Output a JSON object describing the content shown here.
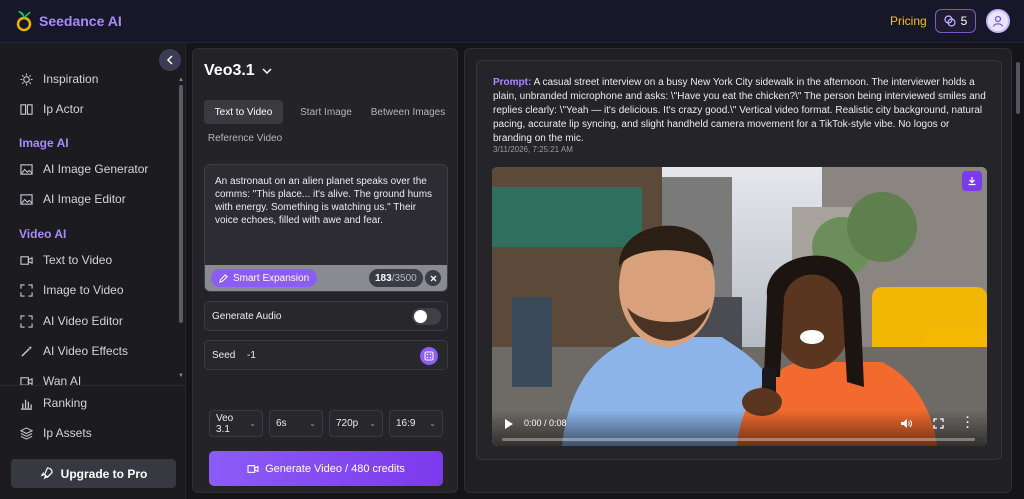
{
  "header": {
    "brand": "Seedance AI",
    "pricing_label": "Pricing",
    "credits": "5",
    "accent_color": "#a78bfa"
  },
  "sidebar": {
    "items_top": [
      {
        "label": "Inspiration",
        "icon": "sun-icon"
      },
      {
        "label": "Ip Actor",
        "icon": "book-icon"
      }
    ],
    "section_image": "Image AI",
    "image_items": [
      {
        "label": "AI Image Generator",
        "icon": "image-icon"
      },
      {
        "label": "AI Image Editor",
        "icon": "image-icon"
      }
    ],
    "section_video": "Video AI",
    "video_items": [
      {
        "label": "Text to Video",
        "icon": "video-icon"
      },
      {
        "label": "Image to Video",
        "icon": "expand-icon"
      },
      {
        "label": "AI Video Editor",
        "icon": "expand-icon"
      },
      {
        "label": "AI Video Effects",
        "icon": "wand-icon"
      },
      {
        "label": "Wan AI",
        "icon": "video-icon"
      }
    ],
    "bottom_items": [
      {
        "label": "Ranking",
        "icon": "bar-chart-icon"
      },
      {
        "label": "Ip Assets",
        "icon": "layers-icon"
      }
    ],
    "upgrade_label": "Upgrade to Pro"
  },
  "generator": {
    "model": "Veo3.1",
    "tabs": [
      "Text to Video",
      "Start Image",
      "Between Images",
      "Reference Video"
    ],
    "active_tab": "Text to Video",
    "prompt": "An astronaut on an alien planet speaks over the comms: \"This place... it's alive. The ground hums with energy. Something is watching us.\" Their voice echoes, filled with awe and fear.",
    "smart_expansion_label": "Smart Expansion",
    "char_count": "183",
    "char_max": "/3500",
    "generate_audio_label": "Generate Audio",
    "generate_audio_on": false,
    "seed_label": "Seed",
    "seed_value": "-1",
    "selects": {
      "model": "Veo 3.1",
      "duration": "6s",
      "resolution": "720p",
      "aspect": "16:9"
    },
    "generate_label": "Generate Video / 480 credits"
  },
  "result": {
    "prompt_label": "Prompt:",
    "prompt_text": "A casual street interview on a busy New York City sidewalk in the afternoon. The interviewer holds a plain, unbranded microphone and asks: \\\"Have you eat the chicken?\\\" The person being interviewed smiles and replies clearly: \\\"Yeah — it's delicious. It's crazy good.\\\" Vertical video format. Realistic city background, natural pacing, accurate lip syncing, and slight handheld camera movement for a TikTok-style vibe. No logos or branding on the mic.",
    "timestamp": "3/11/2026, 7:25:21 AM",
    "video_time": "0:00 / 0:08",
    "progress": 0
  }
}
